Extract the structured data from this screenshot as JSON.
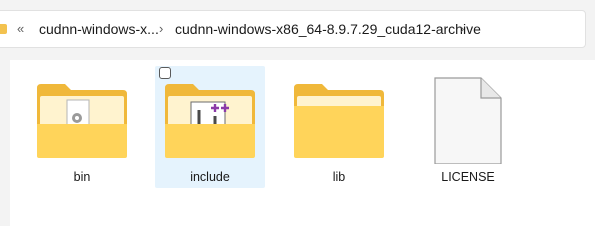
{
  "breadcrumb": {
    "overflow_label": "«",
    "items": [
      {
        "label": "cudnn-windows-x..."
      },
      {
        "label": "cudnn-windows-x86_64-8.9.7.29_cuda12-archive"
      }
    ],
    "separator": "›"
  },
  "files": [
    {
      "name": "bin",
      "type": "folder",
      "overlay": "gear-document"
    },
    {
      "name": "include",
      "type": "folder",
      "overlay": "cpp-header",
      "selected": true
    },
    {
      "name": "lib",
      "type": "folder",
      "overlay": "none"
    },
    {
      "name": "LICENSE",
      "type": "file"
    }
  ],
  "colors": {
    "folder_front": "#ffd45a",
    "folder_back": "#f0b83a",
    "selection": "#e5f3fd",
    "cpp_accent": "#8b3aa8"
  }
}
